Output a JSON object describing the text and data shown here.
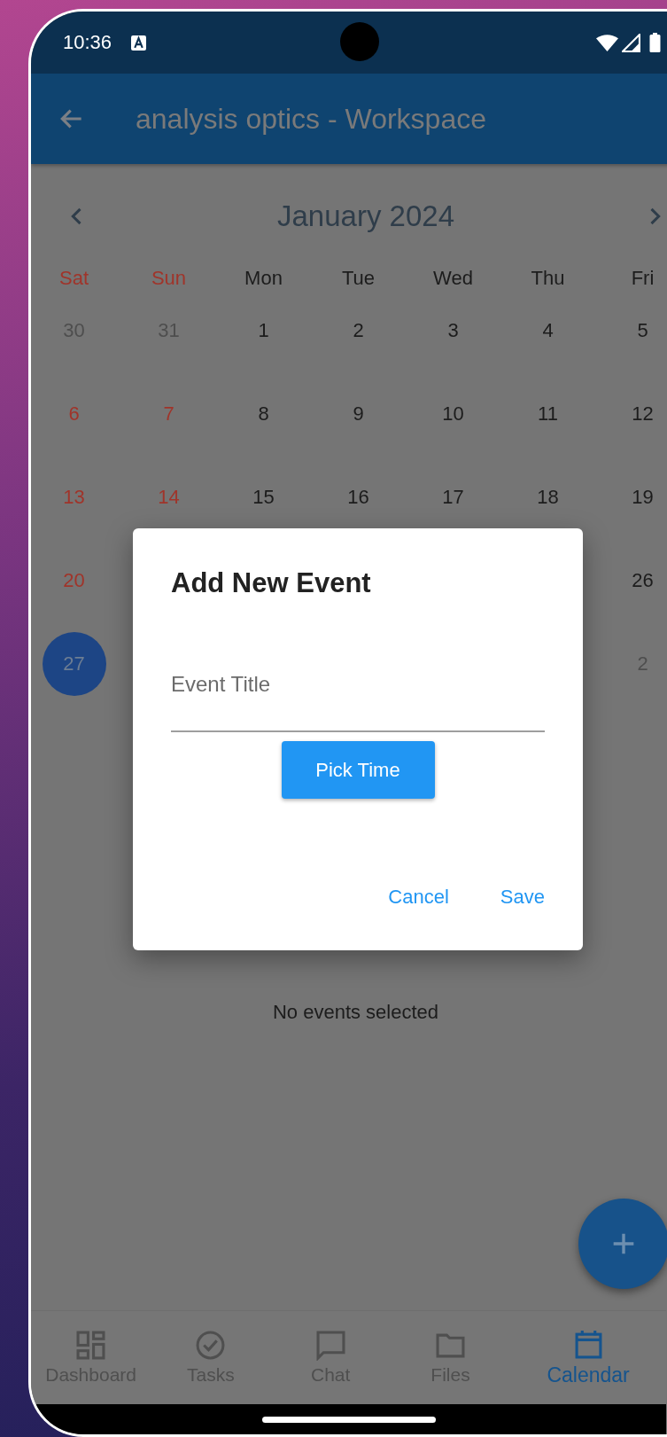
{
  "status_bar": {
    "time": "10:36"
  },
  "app_bar": {
    "title": "analysis optics - Workspace"
  },
  "calendar": {
    "month": "January 2024",
    "weekdays": [
      {
        "label": "Sat",
        "kind": "weekend"
      },
      {
        "label": "Sun",
        "kind": "weekend"
      },
      {
        "label": "Mon",
        "kind": "weekday"
      },
      {
        "label": "Tue",
        "kind": "weekday"
      },
      {
        "label": "Wed",
        "kind": "weekday"
      },
      {
        "label": "Thu",
        "kind": "weekday"
      },
      {
        "label": "Fri",
        "kind": "weekday"
      }
    ],
    "weeks": [
      [
        {
          "day": "30",
          "kind": "other_month",
          "selected": false
        },
        {
          "day": "31",
          "kind": "other_month",
          "selected": false
        },
        {
          "day": "1",
          "kind": "weekday",
          "selected": false
        },
        {
          "day": "2",
          "kind": "weekday",
          "selected": false
        },
        {
          "day": "3",
          "kind": "weekday",
          "selected": false
        },
        {
          "day": "4",
          "kind": "weekday",
          "selected": false
        },
        {
          "day": "5",
          "kind": "weekday",
          "selected": false
        }
      ],
      [
        {
          "day": "6",
          "kind": "weekend",
          "selected": false
        },
        {
          "day": "7",
          "kind": "weekend",
          "selected": false
        },
        {
          "day": "8",
          "kind": "weekday",
          "selected": false
        },
        {
          "day": "9",
          "kind": "weekday",
          "selected": false
        },
        {
          "day": "10",
          "kind": "weekday",
          "selected": false
        },
        {
          "day": "11",
          "kind": "weekday",
          "selected": false
        },
        {
          "day": "12",
          "kind": "weekday",
          "selected": false
        }
      ],
      [
        {
          "day": "13",
          "kind": "weekend",
          "selected": false
        },
        {
          "day": "14",
          "kind": "weekend",
          "selected": false
        },
        {
          "day": "15",
          "kind": "weekday",
          "selected": false
        },
        {
          "day": "16",
          "kind": "weekday",
          "selected": false
        },
        {
          "day": "17",
          "kind": "weekday",
          "selected": false
        },
        {
          "day": "18",
          "kind": "weekday",
          "selected": false
        },
        {
          "day": "19",
          "kind": "weekday",
          "selected": false
        }
      ],
      [
        {
          "day": "20",
          "kind": "weekend",
          "selected": false
        },
        {
          "day": "26",
          "kind": "weekday",
          "selected": false
        }
      ],
      [
        {
          "day": "27",
          "kind": "weekend",
          "selected": true
        },
        {
          "day": "2",
          "kind": "other_month",
          "selected": false
        }
      ]
    ]
  },
  "events_message": "No events selected",
  "dialog": {
    "title": "Add New Event",
    "field": {
      "placeholder": "Event Title"
    },
    "pick_button": "Pick Time",
    "actions": [
      "Cancel",
      "Save"
    ]
  },
  "bottom_nav": [
    {
      "label": "Dashboard",
      "selected": false
    },
    {
      "label": "Tasks",
      "selected": false
    },
    {
      "label": "Chat",
      "selected": false
    },
    {
      "label": "Files",
      "selected": false
    },
    {
      "label": "Calendar",
      "selected": true
    }
  ]
}
